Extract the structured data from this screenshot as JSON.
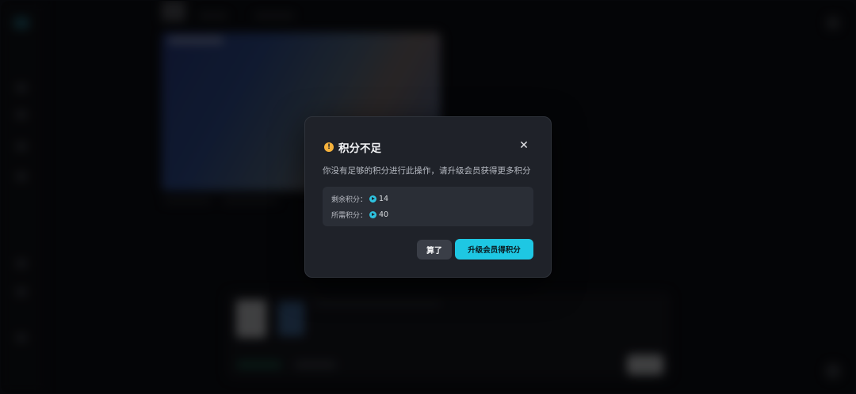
{
  "dialog": {
    "title": "积分不足",
    "icon": "warning-icon",
    "message": "你没有足够的积分进行此操作，请升级会员获得更多积分",
    "remaining_label": "剩余积分：",
    "remaining_value": "14",
    "required_label": "所需积分：",
    "required_value": "40",
    "close_icon": "close-icon",
    "cancel_label": "算了",
    "upgrade_label": "升级会员得积分"
  },
  "colors": {
    "accent": "#1ec7e3",
    "warning": "#f6b23c",
    "dialog_bg": "#1f2229"
  }
}
